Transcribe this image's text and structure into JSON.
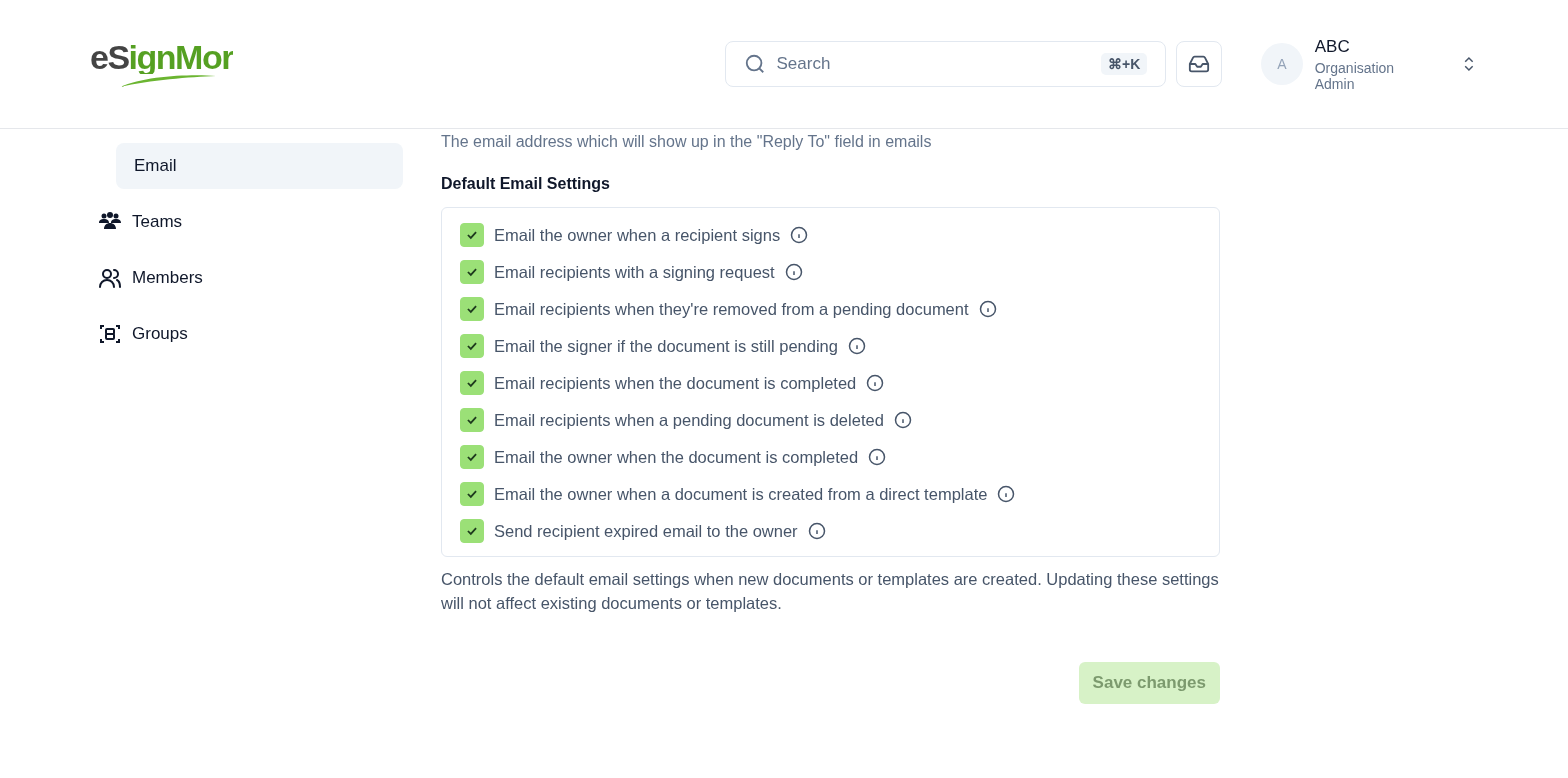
{
  "header": {
    "logo": "eSignMor",
    "search": {
      "placeholder": "Search",
      "shortcut": "⌘+K"
    },
    "user": {
      "avatar": "A",
      "name": "ABC",
      "role": "Organisation Admin"
    }
  },
  "sidebar": {
    "items": [
      {
        "label": "Email",
        "kind": "sub",
        "selected": true
      },
      {
        "label": "Teams",
        "kind": "teams",
        "selected": false
      },
      {
        "label": "Members",
        "kind": "members",
        "selected": false
      },
      {
        "label": "Groups",
        "kind": "groups",
        "selected": false
      }
    ]
  },
  "content": {
    "reply_to_hint": "The email address which will show up in the \"Reply To\" field in emails",
    "section_title": "Default Email Settings",
    "options": [
      {
        "label": "Email the owner when a recipient signs",
        "checked": true
      },
      {
        "label": "Email recipients with a signing request",
        "checked": true
      },
      {
        "label": "Email recipients when they're removed from a pending document",
        "checked": true
      },
      {
        "label": "Email the signer if the document is still pending",
        "checked": true
      },
      {
        "label": "Email recipients when the document is completed",
        "checked": true
      },
      {
        "label": "Email recipients when a pending document is deleted",
        "checked": true
      },
      {
        "label": "Email the owner when the document is completed",
        "checked": true
      },
      {
        "label": "Email the owner when a document is created from a direct template",
        "checked": true
      },
      {
        "label": "Send recipient expired email to the owner",
        "checked": true
      }
    ],
    "description": "Controls the default email settings when new documents or templates are created. Updating these settings will not affect existing documents or templates.",
    "save_button": {
      "label": "Save changes",
      "disabled": true
    }
  }
}
